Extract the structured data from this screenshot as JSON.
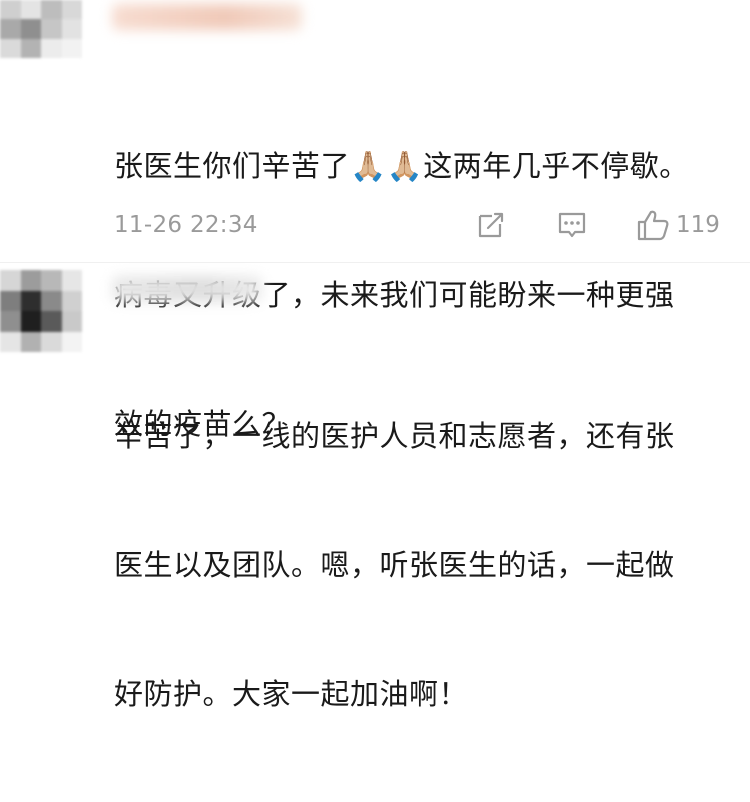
{
  "comments": [
    {
      "lines": [
        "张医生你们辛苦了🙏🏼🙏🏼这两年几乎不停歇。",
        "病毒又升级了，未来我们可能盼来一种更强",
        "效的疫苗么？"
      ],
      "time": "11-26 22:34",
      "likes": "119"
    },
    {
      "lines": [
        "辛苦了，一线的医护人员和志愿者，还有张",
        "医生以及团队。嗯，听张医生的话，一起做",
        "好防护。大家一起加油啊！"
      ]
    }
  ],
  "icons": {
    "share": "share-icon",
    "reply": "comment-icon",
    "like": "thumbs-up-icon"
  },
  "colors": {
    "text": "#1a1a1a",
    "meta": "#9a9a9a"
  }
}
